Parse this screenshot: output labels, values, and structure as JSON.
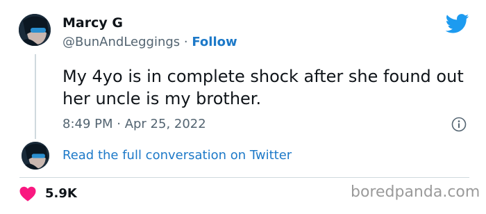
{
  "tweet": {
    "author_name": "Marcy G",
    "handle": "@BunAndLeggings",
    "separator": " · ",
    "follow_label": "Follow",
    "text": "My 4yo is in complete shock after she found out her uncle is my brother.",
    "timestamp": "8:49 PM · Apr 25, 2022",
    "read_more_label": "Read the full conversation on Twitter",
    "like_count": "5.9K"
  },
  "icons": {
    "bird": "twitter-bird-icon",
    "info": "info-icon",
    "heart": "heart-icon"
  },
  "colors": {
    "link_blue": "#1d79c8",
    "twitter_blue": "#1d9bf0",
    "heart_red": "#f91880",
    "muted_text": "#536471"
  },
  "watermark": "boredpanda.com"
}
